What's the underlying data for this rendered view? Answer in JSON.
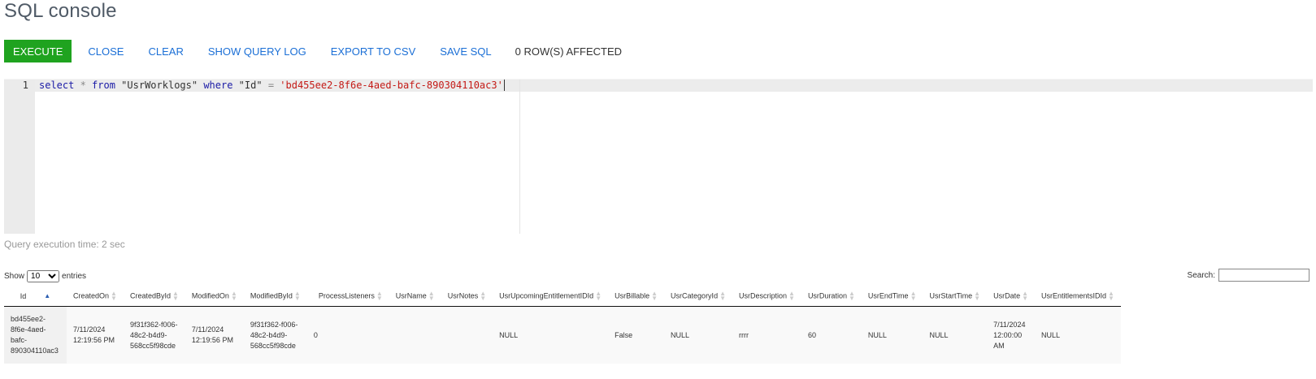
{
  "page": {
    "title": "SQL console"
  },
  "toolbar": {
    "execute": "EXECUTE",
    "close": "CLOSE",
    "clear": "CLEAR",
    "show_query_log": "SHOW QUERY LOG",
    "export_csv": "EXPORT TO CSV",
    "save_sql": "SAVE SQL",
    "status": "0 ROW(S) AFFECTED",
    "execute_color": "#1fa31f",
    "link_color": "#1b6fd6"
  },
  "editor": {
    "line_number": "1",
    "tokens": {
      "select": "select",
      "star": " * ",
      "from": "from",
      "table": " \"UsrWorklogs\" ",
      "where": "where",
      "col": " \"Id\" ",
      "eq": "=",
      "space": " ",
      "value": "'bd455ee2-8f6e-4aed-bafc-890304110ac3'"
    }
  },
  "exec_time": "Query execution time: 2 sec",
  "entries": {
    "show": "Show",
    "selected": "10",
    "entries": "entries"
  },
  "search": {
    "label": "Search:",
    "value": ""
  },
  "table": {
    "columns": [
      "Id",
      "CreatedOn",
      "CreatedById",
      "ModifiedOn",
      "ModifiedById",
      "ProcessListeners",
      "UsrName",
      "UsrNotes",
      "UsrUpcomingEntitlementIDId",
      "UsrBillable",
      "UsrCategoryId",
      "UsrDescription",
      "UsrDuration",
      "UsrEndTime",
      "UsrStartTime",
      "UsrDate",
      "UsrEntitlementsIDId"
    ],
    "row": {
      "id": "bd455ee2-\n8f6e-4aed-\nbafc-\n890304110ac3",
      "created_on": "7/11/2024\n12:19:56 PM",
      "created_by": "9f31f362-f006-\n48c2-b4d9-\n568cc5f98cde",
      "modified_on": "7/11/2024\n12:19:56 PM",
      "modified_by": "9f31f362-f006-\n48c2-b4d9-\n568cc5f98cde",
      "process_listeners": "0",
      "usr_name": "",
      "usr_notes": "",
      "upcoming_entitlement": "NULL",
      "billable": "False",
      "category": "NULL",
      "description": "rrrr",
      "duration": "60",
      "end_time": "NULL",
      "start_time": "NULL",
      "date": "7/11/2024\n12:00:00\nAM",
      "entitlements": "NULL"
    }
  }
}
